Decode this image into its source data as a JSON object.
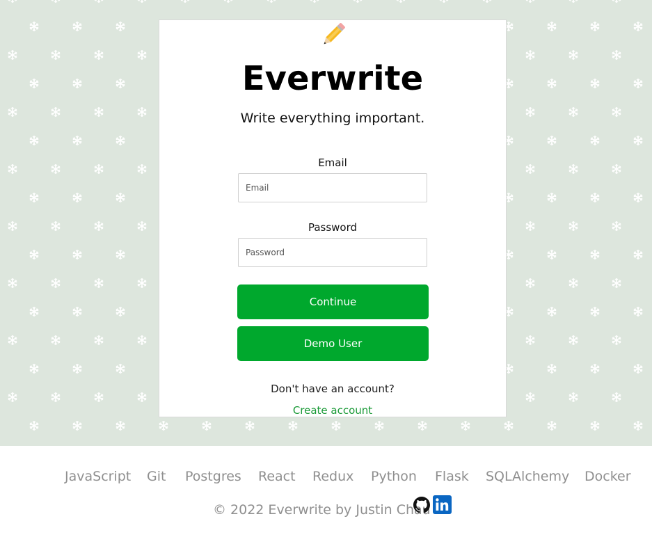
{
  "app": {
    "title": "Everwrite",
    "tagline": "Write everything important."
  },
  "form": {
    "email_label": "Email",
    "email_placeholder": "Email",
    "email_value": "",
    "password_label": "Password",
    "password_placeholder": "Password",
    "password_value": "",
    "continue_label": "Continue",
    "demo_label": "Demo User",
    "no_account_text": "Don't have an account?",
    "create_account_label": "Create account"
  },
  "footer": {
    "technologies": [
      "JavaScript",
      "Git",
      "Postgres",
      "React",
      "Redux",
      "Python",
      "Flask",
      "SQLAlchemy",
      "Docker"
    ],
    "copyright": "© 2022 Everwrite by Justin Chau"
  },
  "icons": {
    "logo": "pencil-icon",
    "github": "github-icon",
    "linkedin": "linkedin-icon"
  },
  "colors": {
    "accent": "#00a82d",
    "link": "#1a9a37",
    "background": "#dde6dd",
    "linkedin": "#0a66c2",
    "footer_text": "#8f8f8f"
  }
}
